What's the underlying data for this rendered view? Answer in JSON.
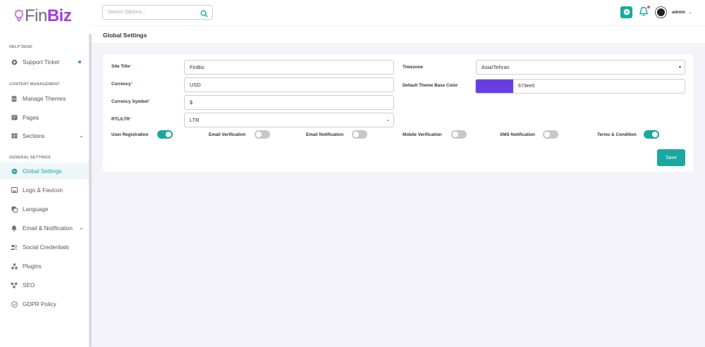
{
  "brand": {
    "part1": "Fin",
    "part2": "Biz"
  },
  "search": {
    "placeholder": "Search Options..."
  },
  "user": {
    "name": "admin"
  },
  "sidebar": {
    "sections": [
      {
        "title": "HELP DESK"
      },
      {
        "title": "CONTENT MANAGEMENT"
      },
      {
        "title": "GENERAL SETTINGS"
      }
    ],
    "items": [
      {
        "label": "Support Ticket"
      },
      {
        "label": "Manage Themes"
      },
      {
        "label": "Pages"
      },
      {
        "label": "Sections"
      },
      {
        "label": "Global Settings"
      },
      {
        "label": "Logo & Favicon"
      },
      {
        "label": "Language"
      },
      {
        "label": "Email & Notification"
      },
      {
        "label": "Social Credentials"
      },
      {
        "label": "Plugins"
      },
      {
        "label": "SEO"
      },
      {
        "label": "GDPR Policy"
      }
    ]
  },
  "page": {
    "title": "Global Settings"
  },
  "form": {
    "site_title": {
      "label": "Site Title",
      "value": "FinBiz"
    },
    "currency": {
      "label": "Currency",
      "value": "USD"
    },
    "currency_symbol": {
      "label": "Currency Symbol",
      "value": "$"
    },
    "rtl_ltr": {
      "label": "RTL/LTR",
      "value": "LTR"
    },
    "timezone": {
      "label": "Timezone",
      "value": "Asia/Tehran"
    },
    "theme_color": {
      "label": "Default Theme Base Color",
      "value": "673ee5",
      "hex": "#673ee5"
    },
    "required_mark": "*"
  },
  "toggles": [
    {
      "label": "User Registration",
      "on": true
    },
    {
      "label": "Email Verification",
      "on": false
    },
    {
      "label": "Email Notification",
      "on": false
    },
    {
      "label": "Mobile Verification",
      "on": false
    },
    {
      "label": "SMS Notification",
      "on": false
    },
    {
      "label": "Terms & Condition",
      "on": true
    }
  ],
  "actions": {
    "save_label": "Save"
  },
  "colors": {
    "accent": "#1aa8a0",
    "brand": "#a53ae0"
  }
}
